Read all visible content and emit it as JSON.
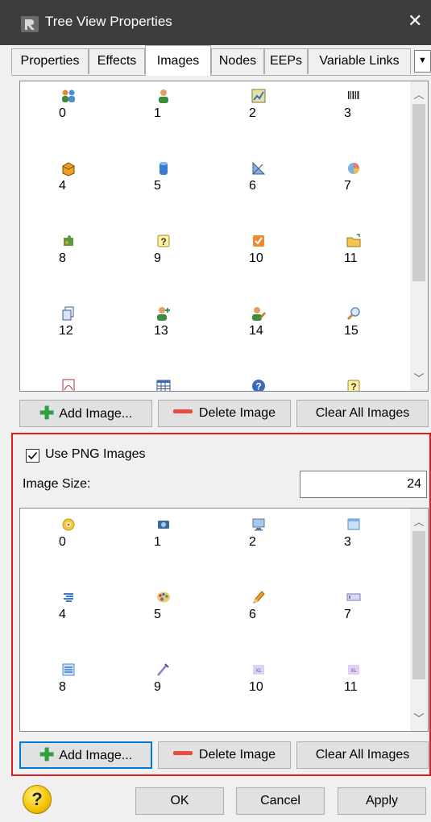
{
  "window": {
    "title": "Tree View Properties",
    "close_glyph": "✕"
  },
  "tabs": [
    {
      "label": "Properties",
      "active": false
    },
    {
      "label": "Effects",
      "active": false
    },
    {
      "label": "Images",
      "active": true
    },
    {
      "label": "Nodes",
      "active": false
    },
    {
      "label": "EEPs",
      "active": false
    },
    {
      "label": "Variable Links",
      "active": false
    }
  ],
  "tab_overflow_glyph": "▼",
  "images_grid": {
    "items": [
      {
        "label": "0",
        "icon": "users-icon"
      },
      {
        "label": "1",
        "icon": "user-icon"
      },
      {
        "label": "2",
        "icon": "chart-edit-icon"
      },
      {
        "label": "3",
        "icon": "barcode-icon"
      },
      {
        "label": "4",
        "icon": "box-icon"
      },
      {
        "label": "5",
        "icon": "database-icon"
      },
      {
        "label": "6",
        "icon": "ruler-triangle-icon"
      },
      {
        "label": "7",
        "icon": "pie-chart-icon"
      },
      {
        "label": "8",
        "icon": "puzzle-icon"
      },
      {
        "label": "9",
        "icon": "help-note-icon"
      },
      {
        "label": "10",
        "icon": "checkbox-icon"
      },
      {
        "label": "11",
        "icon": "folder-open-icon"
      },
      {
        "label": "12",
        "icon": "copy-icon"
      },
      {
        "label": "13",
        "icon": "user-add-icon"
      },
      {
        "label": "14",
        "icon": "user-edit-icon"
      },
      {
        "label": "15",
        "icon": "magnifier-icon"
      },
      {
        "label": "",
        "icon": "pdf-icon"
      },
      {
        "label": "",
        "icon": "table-icon"
      },
      {
        "label": "",
        "icon": "question-circle-icon"
      },
      {
        "label": "",
        "icon": "help-note-icon"
      }
    ]
  },
  "buttons": {
    "add_image": "Add Image...",
    "delete_image": "Delete Image",
    "clear_all": "Clear All Images"
  },
  "png": {
    "use_png_label": "Use PNG Images",
    "use_png_checked": true,
    "image_size_label": "Image Size:",
    "image_size_value": "24",
    "items": [
      {
        "label": "0",
        "icon": "clock-icon"
      },
      {
        "label": "1",
        "icon": "camera-icon"
      },
      {
        "label": "2",
        "icon": "monitor-icon"
      },
      {
        "label": "3",
        "icon": "window-icon"
      },
      {
        "label": "4",
        "icon": "list-icon"
      },
      {
        "label": "5",
        "icon": "palette-icon"
      },
      {
        "label": "6",
        "icon": "pencil-icon"
      },
      {
        "label": "7",
        "icon": "textbox-icon"
      },
      {
        "label": "8",
        "icon": "form-icon"
      },
      {
        "label": "9",
        "icon": "pen-icon"
      },
      {
        "label": "10",
        "icon": "xl-icon"
      },
      {
        "label": "11",
        "icon": "xl-icon"
      }
    ]
  },
  "footer": {
    "help_glyph": "?",
    "ok": "OK",
    "cancel": "Cancel",
    "apply": "Apply"
  },
  "colors": {
    "titlebar": "#3d3d3d",
    "highlight_border": "#e01b24",
    "focus_border": "#0078d7",
    "check_mark": "#000000"
  }
}
